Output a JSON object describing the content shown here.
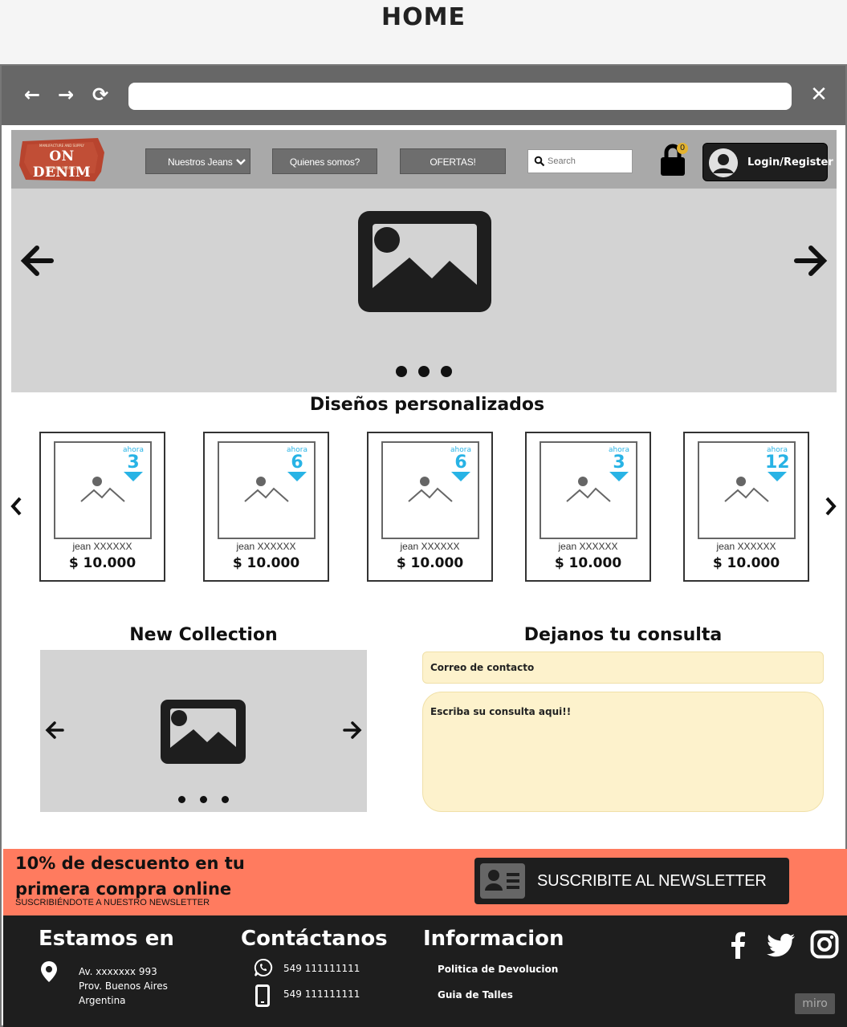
{
  "page": {
    "title": "HOME"
  },
  "browser": {
    "back": "←",
    "forward": "→",
    "reload": "⟳",
    "close": "✕",
    "url": ""
  },
  "header": {
    "logo_text": "ON DENIM",
    "logo_top": "MANUFACTURE AND SUPPLY",
    "logo_bottom": "FINISHED PRODUCT",
    "menu": [
      {
        "label": "Nuestros Jeans",
        "dropdown": true
      },
      {
        "label": "Quienes somos?"
      },
      {
        "label": "OFERTAS!"
      }
    ],
    "search_placeholder": "Search",
    "cart_count": "0",
    "login_label": "Login/Register"
  },
  "hero": {
    "dots": 3
  },
  "products": {
    "title": "Diseños personalizados",
    "items": [
      {
        "name": "jean XXXXXX",
        "price": "$ 10.000",
        "badge_label": "ahora",
        "installments": "3"
      },
      {
        "name": "jean XXXXXX",
        "price": "$ 10.000",
        "badge_label": "ahora",
        "installments": "6"
      },
      {
        "name": "jean XXXXXX",
        "price": "$ 10.000",
        "badge_label": "ahora",
        "installments": "6"
      },
      {
        "name": "jean XXXXXX",
        "price": "$ 10.000",
        "badge_label": "ahora",
        "installments": "3"
      },
      {
        "name": "jean XXXXXX",
        "price": "$ 10.000",
        "badge_label": "ahora",
        "installments": "12"
      }
    ]
  },
  "collection": {
    "title": "New Collection"
  },
  "contact_form": {
    "title": "Dejanos tu consulta",
    "email_placeholder": "Correo de contacto",
    "message_placeholder": "Escriba su consulta aqui!!"
  },
  "promo": {
    "headline": "10% de descuento en tu primera compra online",
    "subtext": "SUSCRIBIÉNDOTE A NUESTRO NEWSLETTER",
    "button_label": "SUSCRIBITE AL NEWSLETTER"
  },
  "footer": {
    "location": {
      "title": "Estamos en",
      "lines": [
        "Av. xxxxxxx 993",
        "Prov. Buenos Aires",
        "Argentina"
      ]
    },
    "contact": {
      "title": "Contáctanos",
      "whatsapp": "549 111111111",
      "phone": "549 111111111"
    },
    "info": {
      "title": "Informacion",
      "links": [
        "Politica de Devolucion",
        "Guia de Talles"
      ]
    },
    "watermark": "miro"
  },
  "colors": {
    "promo_bg": "#ff7b5f",
    "form_field_bg": "#fdf2cc",
    "badge_blue": "#28b3e5",
    "footer_bg": "#1e1e1e"
  }
}
